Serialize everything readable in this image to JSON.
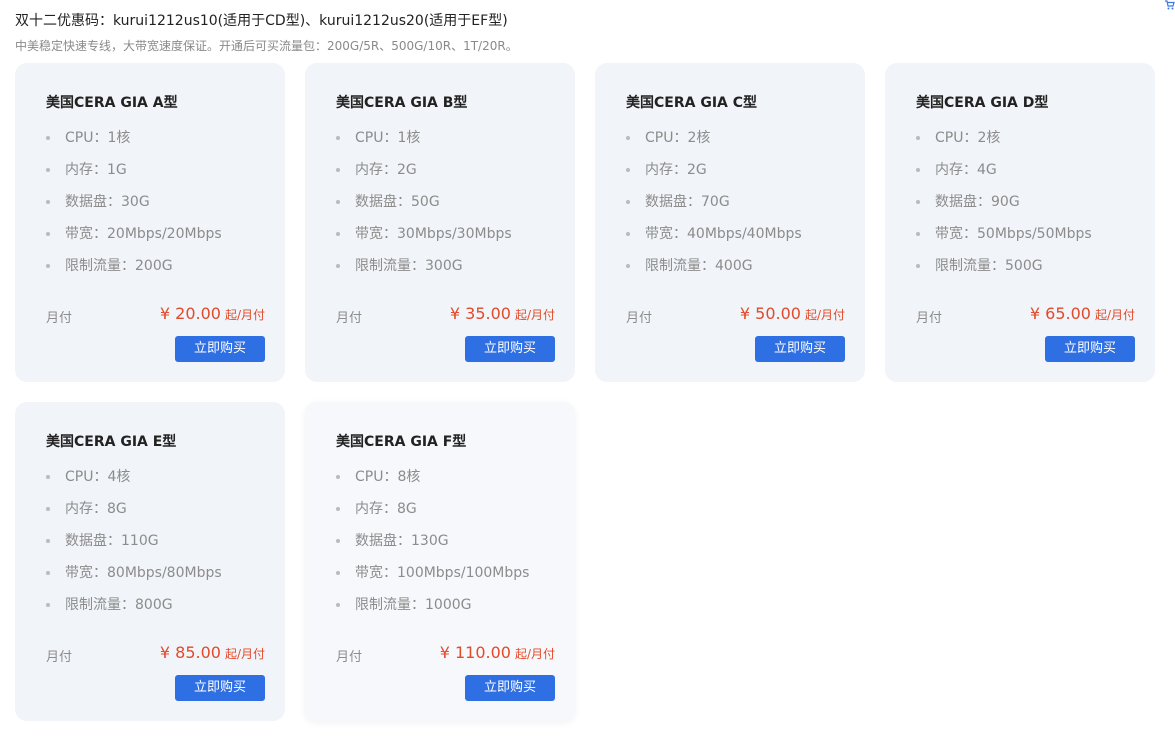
{
  "promo": {
    "title": "双十二优惠码：kurui1212us10(适用于CD型)、kurui1212us20(适用于EF型)",
    "subtitle": "中美稳定快速专线，大带宽速度保证。开通后可买流量包：200G/5R、500G/10R、1T/20R。"
  },
  "icons": {
    "cart": "shopping-cart-icon"
  },
  "colors": {
    "card_bg": "#f1f4f8",
    "price": "#e24a2a",
    "button": "#2f6fe4"
  },
  "plans": [
    {
      "name": "美国CERA GIA A型",
      "specs": [
        "CPU：1核",
        "内存：1G",
        "数据盘：30G",
        "带宽：20Mbps/20Mbps",
        "限制流量：200G"
      ],
      "billing": "月付",
      "price": "¥ 20.00",
      "price_unit": "起/月付",
      "button": "立即购买"
    },
    {
      "name": "美国CERA GIA B型",
      "specs": [
        "CPU：1核",
        "内存：2G",
        "数据盘：50G",
        "带宽：30Mbps/30Mbps",
        "限制流量：300G"
      ],
      "billing": "月付",
      "price": "¥ 35.00",
      "price_unit": "起/月付",
      "button": "立即购买"
    },
    {
      "name": "美国CERA GIA C型",
      "specs": [
        "CPU：2核",
        "内存：2G",
        "数据盘：70G",
        "带宽：40Mbps/40Mbps",
        "限制流量：400G"
      ],
      "billing": "月付",
      "price": "¥ 50.00",
      "price_unit": "起/月付",
      "button": "立即购买"
    },
    {
      "name": "美国CERA GIA D型",
      "specs": [
        "CPU：2核",
        "内存：4G",
        "数据盘：90G",
        "带宽：50Mbps/50Mbps",
        "限制流量：500G"
      ],
      "billing": "月付",
      "price": "¥ 65.00",
      "price_unit": "起/月付",
      "button": "立即购买"
    },
    {
      "name": "美国CERA GIA E型",
      "specs": [
        "CPU：4核",
        "内存：8G",
        "数据盘：110G",
        "带宽：80Mbps/80Mbps",
        "限制流量：800G"
      ],
      "billing": "月付",
      "price": "¥ 85.00",
      "price_unit": "起/月付",
      "button": "立即购买"
    },
    {
      "name": "美国CERA GIA F型",
      "specs": [
        "CPU：8核",
        "内存：8G",
        "数据盘：130G",
        "带宽：100Mbps/100Mbps",
        "限制流量：1000G"
      ],
      "billing": "月付",
      "price": "¥ 110.00",
      "price_unit": "起/月付",
      "button": "立即购买"
    }
  ]
}
